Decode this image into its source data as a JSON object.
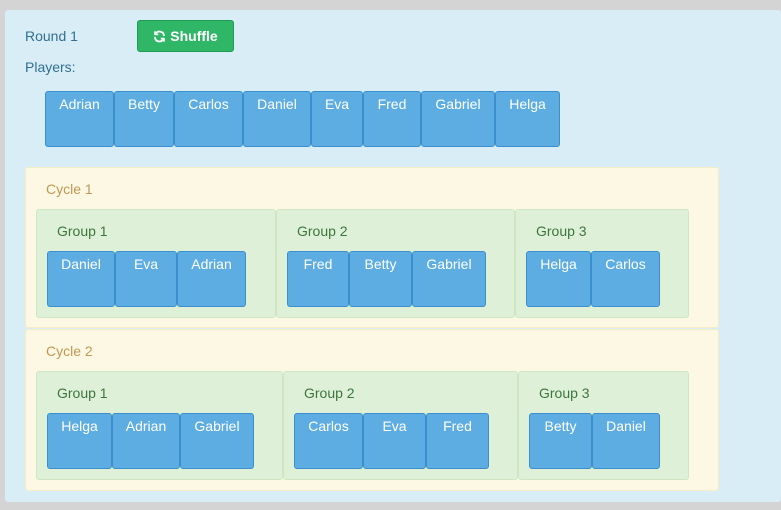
{
  "round": {
    "label": "Round 1"
  },
  "toolbar": {
    "shuffle_label": "Shuffle",
    "shuffle_icon": "refresh-icon"
  },
  "players": {
    "label": "Players:",
    "names": [
      "Adrian",
      "Betty",
      "Carlos",
      "Daniel",
      "Eva",
      "Fred",
      "Gabriel",
      "Helga"
    ]
  },
  "cycles": [
    {
      "title": "Cycle 1",
      "groups": [
        {
          "title": "Group 1",
          "members": [
            "Daniel",
            "Eva",
            "Adrian"
          ]
        },
        {
          "title": "Group 2",
          "members": [
            "Fred",
            "Betty",
            "Gabriel"
          ]
        },
        {
          "title": "Group 3",
          "members": [
            "Helga",
            "Carlos"
          ]
        }
      ]
    },
    {
      "title": "Cycle 2",
      "groups": [
        {
          "title": "Group 1",
          "members": [
            "Helga",
            "Adrian",
            "Gabriel"
          ]
        },
        {
          "title": "Group 2",
          "members": [
            "Carlos",
            "Eva",
            "Fred"
          ]
        },
        {
          "title": "Group 3",
          "members": [
            "Betty",
            "Daniel"
          ]
        }
      ]
    }
  ],
  "colors": {
    "panel": "#d9edf7",
    "shuffle": "#2fb767",
    "chip": "#5dade2",
    "cycle": "#fcf8e3",
    "group": "#dff0d8"
  }
}
